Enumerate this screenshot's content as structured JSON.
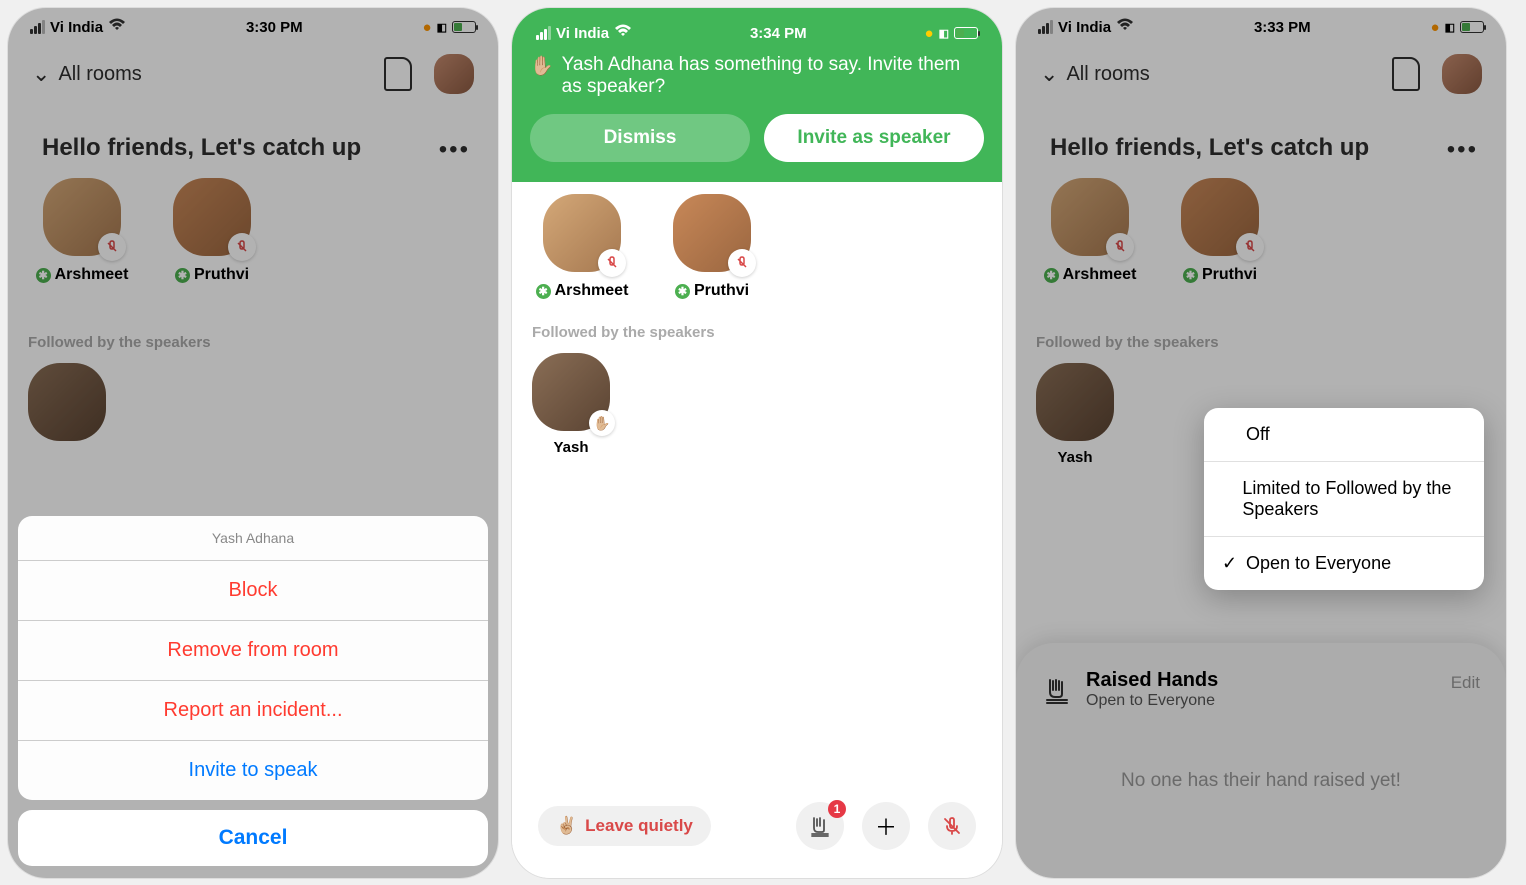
{
  "status": {
    "carrier": "Vi India",
    "time1": "3:30 PM",
    "time2": "3:34 PM",
    "time3": "3:33 PM"
  },
  "header": {
    "all_rooms": "All rooms"
  },
  "room": {
    "title": "Hello friends, Let's catch up",
    "speakers": [
      {
        "name": "Arshmeet"
      },
      {
        "name": "Pruthvi"
      }
    ],
    "followed_label": "Followed by the speakers",
    "listener": "Yash"
  },
  "sheet": {
    "title": "Yash Adhana",
    "block": "Block",
    "remove": "Remove from room",
    "report": "Report an incident...",
    "invite": "Invite to speak",
    "cancel": "Cancel"
  },
  "banner": {
    "emoji": "✋🏼",
    "text": "Yash Adhana has something to say. Invite them as speaker?",
    "dismiss": "Dismiss",
    "invite": "Invite as speaker"
  },
  "bottom": {
    "leave": "Leave quietly",
    "badge": "1"
  },
  "popover": {
    "off": "Off",
    "limited": "Limited to Followed by the Speakers",
    "open": "Open to Everyone"
  },
  "raised": {
    "title": "Raised Hands",
    "subtitle": "Open to Everyone",
    "edit": "Edit",
    "empty": "No one has their hand raised yet!"
  }
}
